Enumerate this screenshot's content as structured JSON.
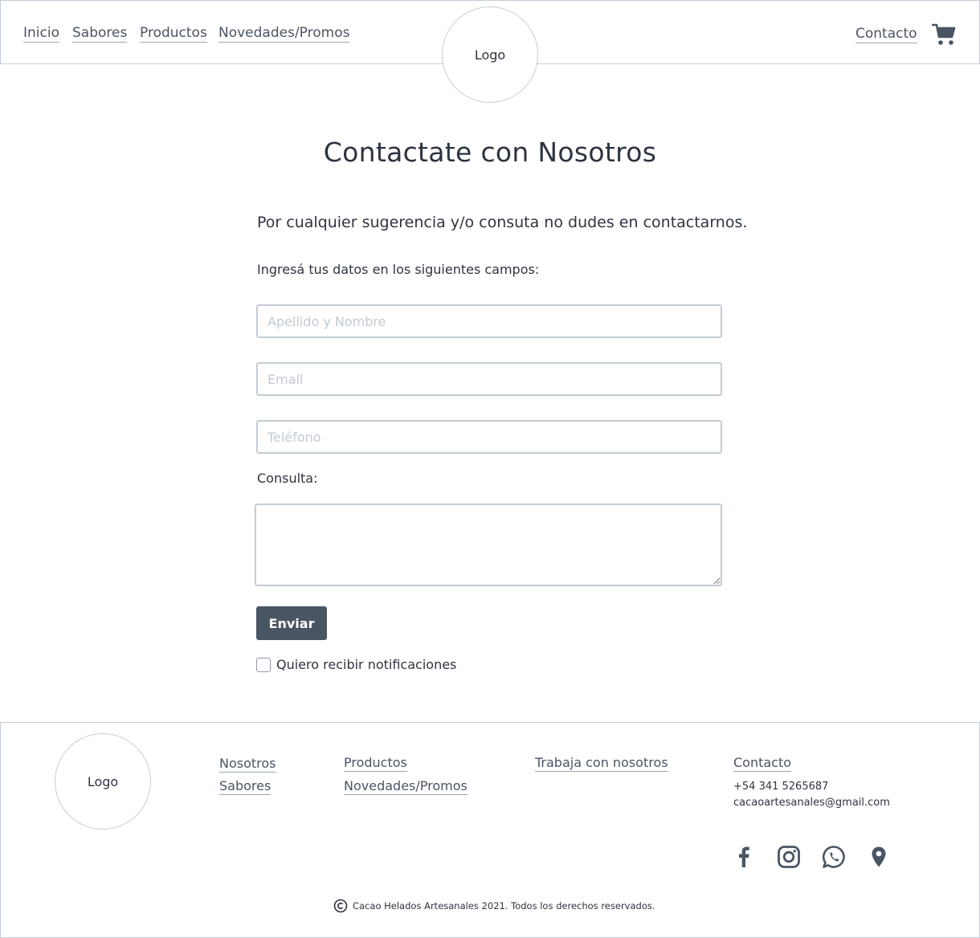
{
  "header": {
    "nav": [
      "Inicio",
      "Sabores",
      "Productos",
      "Novedades/Promos"
    ],
    "logo": "Logo",
    "contact": "Contacto",
    "cart_icon": "shopping-cart-icon"
  },
  "main": {
    "title": "Contactate con Nosotros",
    "intro": "Por cualquier sugerencia y/o consuta no dudes en contactarnos.",
    "instructions": "Ingresá tus datos en los siguientes campos:",
    "fields": {
      "name_placeholder": "Apellido y Nombre",
      "email_placeholder": "Email",
      "phone_placeholder": "Teléfono"
    },
    "consulta_label": "Consulta:",
    "submit_label": "Enviar",
    "notify_label": "Quiero recibir notificaciones"
  },
  "footer": {
    "logo": "Logo",
    "col1": [
      "Nosotros",
      "Sabores"
    ],
    "col2": [
      "Productos",
      "Novedades/Promos"
    ],
    "col3": [
      "Trabaja con nosotros"
    ],
    "contact_heading": "Contacto",
    "phone": "+54 341 5265687",
    "email": "cacaoartesanales@gmail.com",
    "social_icons": [
      "facebook-icon",
      "instagram-icon",
      "whatsapp-icon",
      "location-pin-icon"
    ],
    "copyright": "Cacao Helados Artesanales 2021. Todos los derechos reservados."
  },
  "colors": {
    "accent": "#4a5563",
    "border": "#c5cdd6",
    "text": "#2d3440"
  }
}
